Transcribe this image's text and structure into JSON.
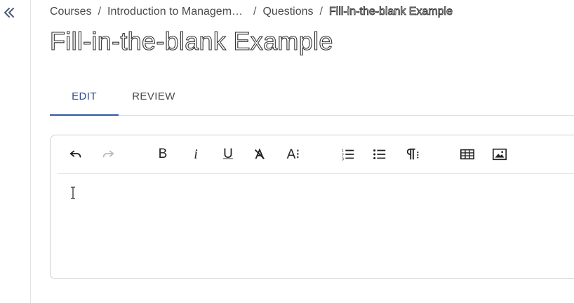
{
  "breadcrumb": {
    "items": [
      "Courses",
      "Introduction to Managem…",
      "Questions"
    ],
    "current": "Fill-in-the-blank Example",
    "separator": "/"
  },
  "page": {
    "title": "Fill-in-the-blank Example"
  },
  "tabs": [
    {
      "label": "EDIT",
      "selected": true
    },
    {
      "label": "REVIEW",
      "selected": false
    }
  ],
  "toolbar": {
    "bold": "B",
    "italic": "i",
    "underline": "U",
    "font_size": "A⁝"
  },
  "editor": {
    "content": ""
  }
}
